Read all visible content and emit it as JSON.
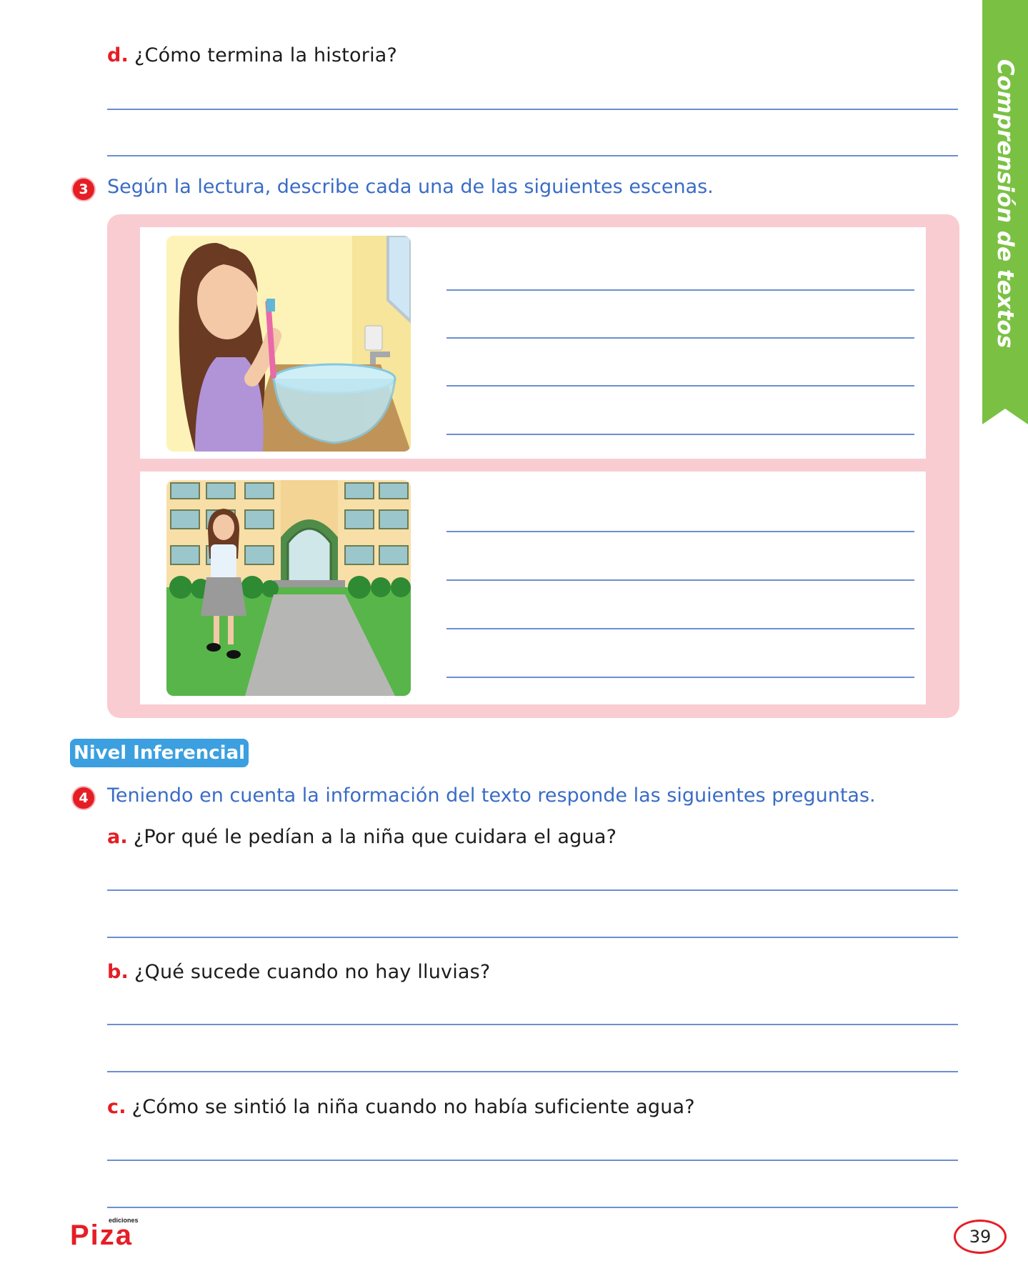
{
  "side_tab": {
    "label": "Comprensión de textos"
  },
  "question_d": {
    "letter": "d.",
    "text": "¿Cómo termina la historia?"
  },
  "section3": {
    "number": "3",
    "instruction": "Según la lectura, describe cada una de las siguientes escenas."
  },
  "scenes": [
    {
      "icon": "girl-brushing-teeth-illustration"
    },
    {
      "icon": "girl-walking-to-school-illustration"
    }
  ],
  "level_badge": "Nivel Inferencial",
  "section4": {
    "number": "4",
    "instruction": "Teniendo en cuenta la información del texto responde las siguientes preguntas.",
    "questions": [
      {
        "letter": "a.",
        "text": "¿Por qué le pedían a la niña que cuidara el agua?"
      },
      {
        "letter": "b.",
        "text": "¿Qué sucede cuando no hay lluvias?"
      },
      {
        "letter": "c.",
        "text": "¿Cómo se sintió la niña cuando no había suficiente agua?"
      }
    ]
  },
  "footer": {
    "logo_small": "ediciones",
    "logo_main": "Piza",
    "page_number": "39"
  },
  "colors": {
    "accent_red": "#e51e25",
    "instruction_blue": "#3a6cc6",
    "tab_green": "#7ac143",
    "box_pink": "#f9ccd2",
    "badge_blue": "#3b9fe0"
  }
}
